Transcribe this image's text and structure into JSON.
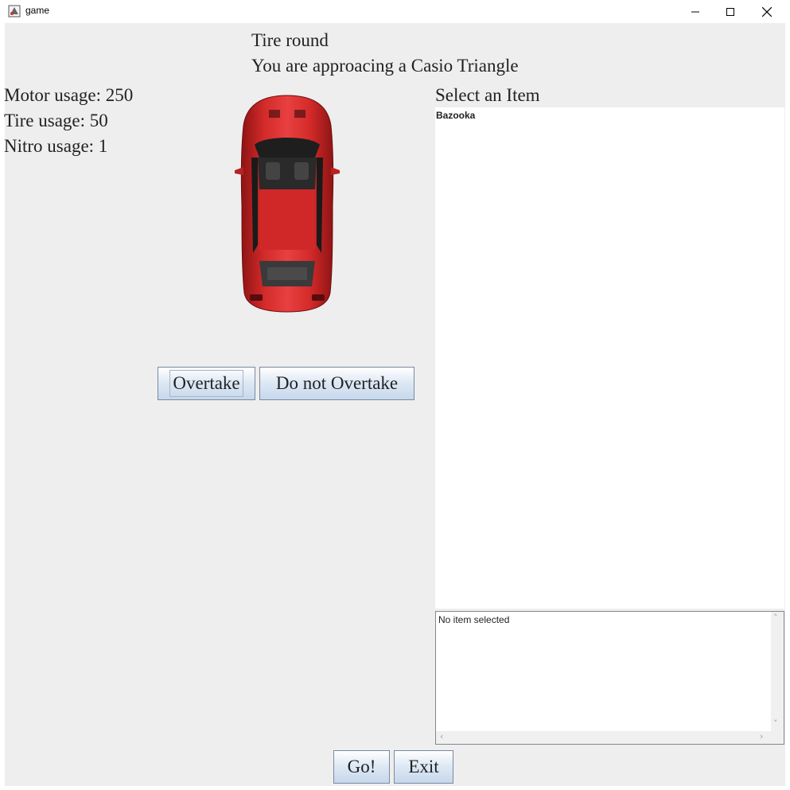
{
  "window": {
    "title": "game",
    "icon": "java-app-icon"
  },
  "window_controls": {
    "minimize": "minimize-icon",
    "maximize": "maximize-icon",
    "close": "close-icon"
  },
  "header": {
    "round_title": "Tire round",
    "approach_text": "You are approacing a Casio Triangle"
  },
  "stats": {
    "motor": "Motor usage: 250",
    "tire": "Tire usage: 50",
    "nitro": "Nitro usage: 1"
  },
  "car": {
    "color": "#d32a2a",
    "description": "red-car-top-view"
  },
  "actions": {
    "overtake": "Overtake",
    "do_not_overtake": "Do not Overtake"
  },
  "items": {
    "label": "Select an Item",
    "list": [
      "Bazooka"
    ]
  },
  "description": {
    "text": "No item selected"
  },
  "footer": {
    "go": "Go!",
    "exit": "Exit"
  }
}
